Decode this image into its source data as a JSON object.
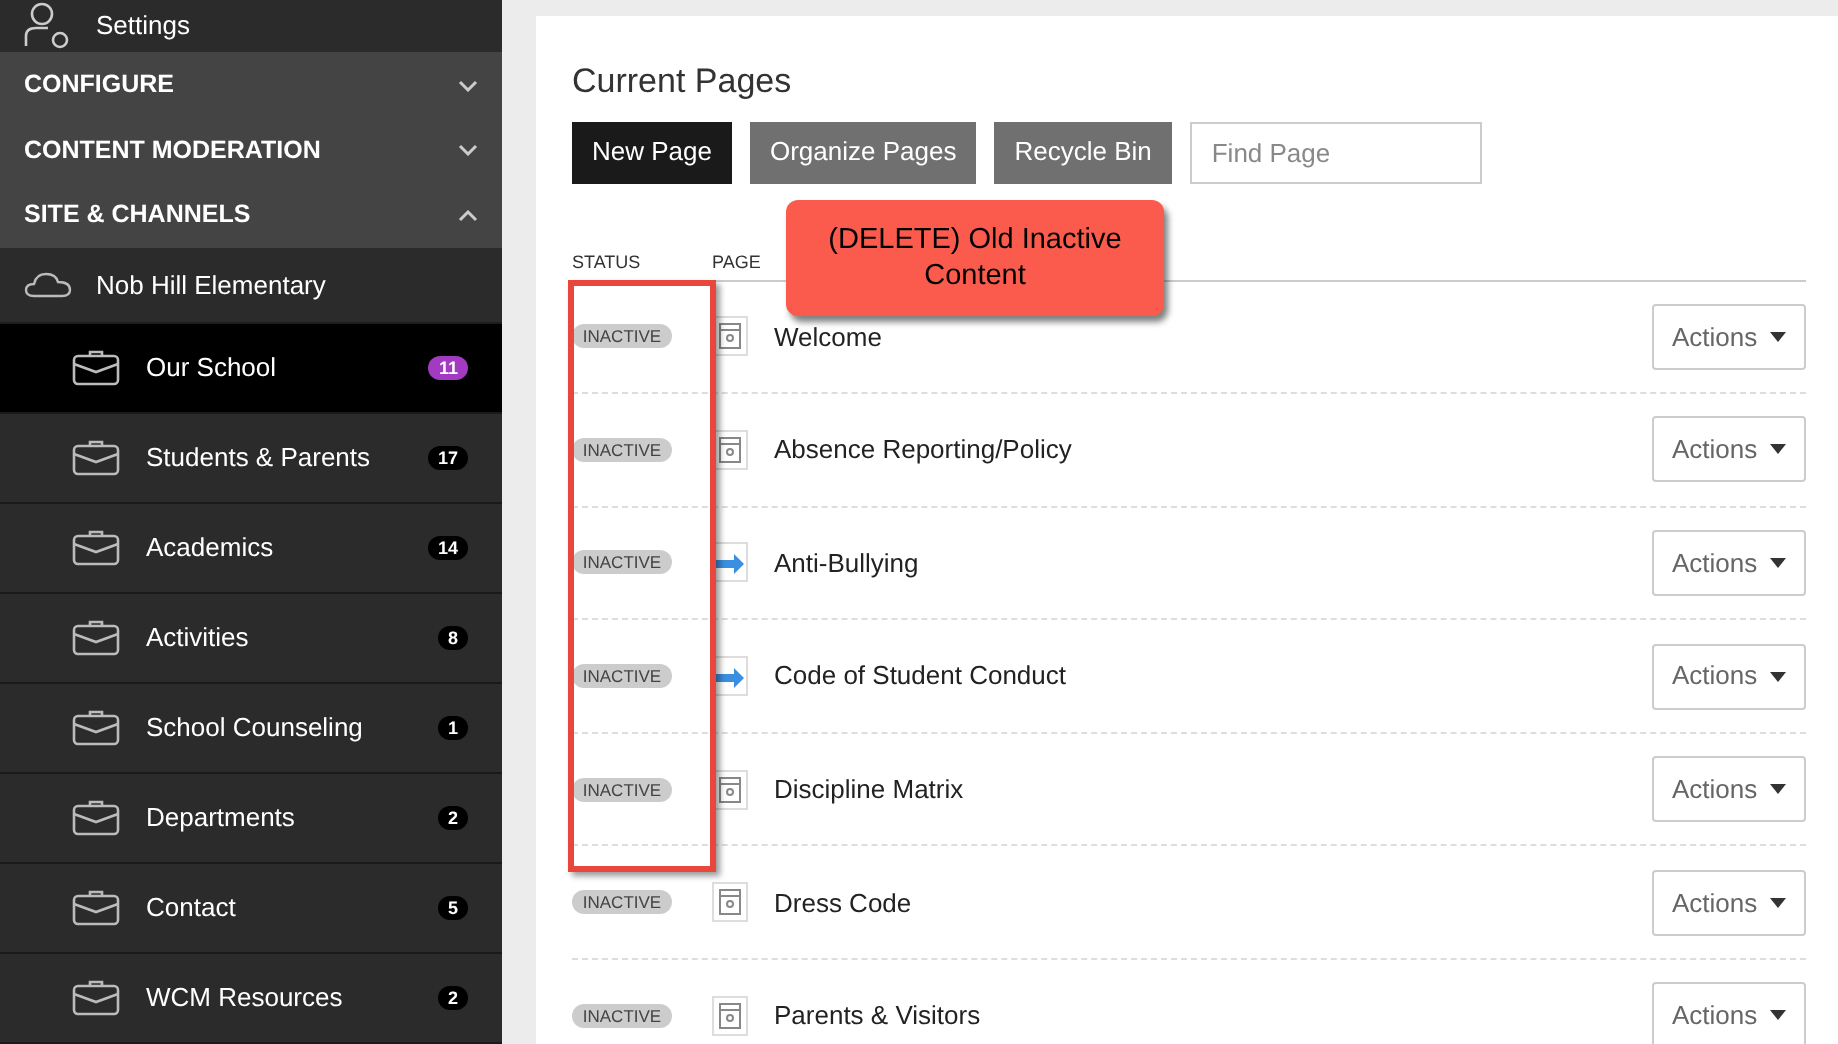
{
  "sidebar": {
    "settings": "Settings",
    "sections": [
      {
        "label": "CONFIGURE",
        "expanded": false
      },
      {
        "label": "CONTENT MODERATION",
        "expanded": false
      },
      {
        "label": "SITE & CHANNELS",
        "expanded": true
      }
    ],
    "site": "Nob Hill Elementary",
    "channels": [
      {
        "label": "Our School",
        "count": "11",
        "selected": true
      },
      {
        "label": "Students & Parents",
        "count": "17",
        "selected": false
      },
      {
        "label": "Academics",
        "count": "14",
        "selected": false
      },
      {
        "label": "Activities",
        "count": "8",
        "selected": false
      },
      {
        "label": "School Counseling",
        "count": "1",
        "selected": false
      },
      {
        "label": "Departments",
        "count": "2",
        "selected": false
      },
      {
        "label": "Contact",
        "count": "5",
        "selected": false
      },
      {
        "label": "WCM Resources",
        "count": "2",
        "selected": false
      }
    ]
  },
  "main": {
    "title": "Current Pages",
    "buttons": [
      {
        "label": "New Page",
        "primary": true
      },
      {
        "label": "Organize Pages",
        "primary": false
      },
      {
        "label": "Recycle Bin",
        "primary": false
      }
    ],
    "search": {
      "placeholder": "Find Page"
    },
    "columns": [
      "STATUS",
      "PAGE"
    ],
    "rows": [
      {
        "status": "INACTIVE",
        "kind": "page",
        "title": "Welcome",
        "action": "Actions"
      },
      {
        "status": "INACTIVE",
        "kind": "page",
        "title": "Absence Reporting/Policy",
        "action": "Actions"
      },
      {
        "status": "INACTIVE",
        "kind": "link",
        "title": "Anti-Bullying",
        "action": "Actions"
      },
      {
        "status": "INACTIVE",
        "kind": "link",
        "title": "Code of Student Conduct",
        "action": "Actions"
      },
      {
        "status": "INACTIVE",
        "kind": "page",
        "title": "Discipline Matrix",
        "action": "Actions"
      },
      {
        "status": "INACTIVE",
        "kind": "page",
        "title": "Dress Code",
        "action": "Actions"
      },
      {
        "status": "INACTIVE",
        "kind": "page",
        "title": "Parents & Visitors",
        "action": "Actions"
      }
    ]
  },
  "callout": "(DELETE) Old Inactive Content"
}
